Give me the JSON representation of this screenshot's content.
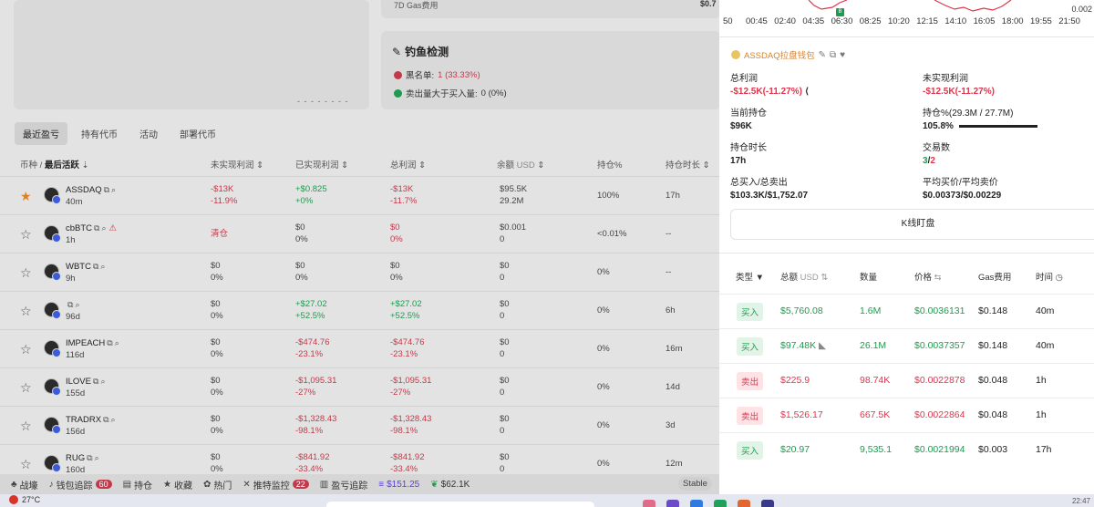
{
  "left": {
    "gas7d_label": "7D Gas费用",
    "gas7d_value": "$0.7",
    "dashes": "- - - - - - - -",
    "phishing": {
      "title": "钓鱼检测",
      "blacklist_label": "黑名单:",
      "blacklist_value": "1 (33.33%)",
      "sell_label": "卖出量大于买入量:",
      "sell_value": "0 (0%)"
    },
    "tabs": [
      "最近盈亏",
      "持有代币",
      "活动",
      "部署代币"
    ],
    "columns": {
      "token": "币种 / ",
      "last_active": "最后活跃",
      "unrealized": "未实现利润",
      "realized": "已实现利润",
      "total": "总利润",
      "balance": "余额",
      "balance_unit": "USD",
      "position": "持仓%",
      "hold_time": "持仓时长"
    },
    "rows": [
      {
        "name": "ASSDAQ",
        "age": "40m",
        "u1": "-$13K",
        "u2": "-11.9%",
        "r1": "+$0.825",
        "r2": "+0%",
        "t1": "-$13K",
        "t2": "-11.7%",
        "b1": "$95.5K",
        "b2": "29.2M",
        "pos": "100%",
        "time": "17h"
      },
      {
        "name": "cbBTC",
        "age": "1h",
        "u1": "清仓",
        "u2": "",
        "r1": "$0",
        "r2": "0%",
        "t1": "$0",
        "t2": "0%",
        "b1": "$0.001",
        "b2": "0",
        "pos": "<0.01%",
        "time": "--"
      },
      {
        "name": "WBTC",
        "age": "9h",
        "u1": "$0",
        "u2": "0%",
        "r1": "$0",
        "r2": "0%",
        "t1": "$0",
        "t2": "0%",
        "b1": "$0",
        "b2": "0",
        "pos": "0%",
        "time": "--"
      },
      {
        "name": "",
        "age": "96d",
        "u1": "$0",
        "u2": "0%",
        "r1": "+$27.02",
        "r2": "+52.5%",
        "t1": "+$27.02",
        "t2": "+52.5%",
        "b1": "$0",
        "b2": "0",
        "pos": "0%",
        "time": "6h"
      },
      {
        "name": "IMPEACH",
        "age": "116d",
        "u1": "$0",
        "u2": "0%",
        "r1": "-$474.76",
        "r2": "-23.1%",
        "t1": "-$474.76",
        "t2": "-23.1%",
        "b1": "$0",
        "b2": "0",
        "pos": "0%",
        "time": "16m"
      },
      {
        "name": "ILOVE",
        "age": "155d",
        "u1": "$0",
        "u2": "0%",
        "r1": "-$1,095.31",
        "r2": "-27%",
        "t1": "-$1,095.31",
        "t2": "-27%",
        "b1": "$0",
        "b2": "0",
        "pos": "0%",
        "time": "14d"
      },
      {
        "name": "TRADRX",
        "age": "156d",
        "u1": "$0",
        "u2": "0%",
        "r1": "-$1,328.43",
        "r2": "-98.1%",
        "t1": "-$1,328.43",
        "t2": "-98.1%",
        "b1": "$0",
        "b2": "0",
        "pos": "0%",
        "time": "3d"
      },
      {
        "name": "RUG",
        "age": "160d",
        "u1": "$0",
        "u2": "0%",
        "r1": "-$841.92",
        "r2": "-33.4%",
        "t1": "-$841.92",
        "t2": "-33.4%",
        "b1": "$0",
        "b2": "0",
        "pos": "0%",
        "time": "12m"
      }
    ],
    "bottom": [
      {
        "label": "战壕",
        "icon": "tree-icon"
      },
      {
        "label": "钱包追踪",
        "icon": "bell-icon",
        "badge": "60"
      },
      {
        "label": "持仓",
        "icon": "chart-icon"
      },
      {
        "label": "收藏",
        "icon": "star-icon"
      },
      {
        "label": "热门",
        "icon": "gear-icon"
      },
      {
        "label": "推特监控",
        "icon": "x-icon",
        "badge": "22"
      },
      {
        "label": "盈亏追踪",
        "icon": "bars-icon"
      },
      {
        "label": "$151.25",
        "icon": "solana-icon"
      },
      {
        "label": "$62.1K",
        "icon": "leaf-icon"
      }
    ],
    "stable": "Stable",
    "taskbar": {
      "weather": "27°C",
      "time": "22:47"
    }
  },
  "panel": {
    "axis_labels": [
      "50",
      "00:45",
      "02:40",
      "04:35",
      "06:30",
      "08:25",
      "10:20",
      "12:15",
      "14:10",
      "16:05",
      "18:00",
      "19:55",
      "21:50"
    ],
    "axis_max": "0.002",
    "marker": "B",
    "wallet_name": "ASSDAQ拉盘钱包",
    "stats": {
      "total_profit_label": "总利润",
      "total_profit_value": "-$12.5K(-11.27%)",
      "unrealized_label": "未实现利润",
      "unrealized_value": "-$12.5K(-11.27%)",
      "holding_label": "当前持仓",
      "holding_value": "$96K",
      "holding_pct_label": "持仓%(29.3M / 27.7M)",
      "holding_pct_value": "105.8%",
      "holding_pct_fraction": 1.0,
      "hold_time_label": "持仓时长",
      "hold_time_value": "17h",
      "trades_label": "交易数",
      "trades_buy": "3",
      "trades_sep": "/",
      "trades_sell": "2",
      "bs_label": "总买入/总卖出",
      "bs_value": "$103.3K/$1,752.07",
      "avg_label": "平均买价/平均卖价",
      "avg_value": "$0.00373/$0.00229"
    },
    "kline_button": "K线盯盘",
    "trade_cols": {
      "type": "类型",
      "total": "总额",
      "total_unit": "USD",
      "qty": "数量",
      "price": "价格",
      "gas": "Gas费用",
      "time": "时间"
    },
    "trades": [
      {
        "type": "买入",
        "side": "buy",
        "total": "$5,760.08",
        "qty": "1.6M",
        "price": "$0.0036131",
        "gas": "$0.148",
        "time": "40m"
      },
      {
        "type": "买入",
        "side": "buy",
        "total": "$97.48K",
        "qty": "26.1M",
        "price": "$0.0037357",
        "gas": "$0.148",
        "time": "40m"
      },
      {
        "type": "卖出",
        "side": "sell",
        "total": "$225.9",
        "qty": "98.74K",
        "price": "$0.0022878",
        "gas": "$0.048",
        "time": "1h"
      },
      {
        "type": "卖出",
        "side": "sell",
        "total": "$1,526.17",
        "qty": "667.5K",
        "price": "$0.0022864",
        "gas": "$0.048",
        "time": "1h"
      },
      {
        "type": "买入",
        "side": "buy",
        "total": "$20.97",
        "qty": "9,535.1",
        "price": "$0.0021994",
        "gas": "$0.003",
        "time": "17h"
      }
    ]
  }
}
